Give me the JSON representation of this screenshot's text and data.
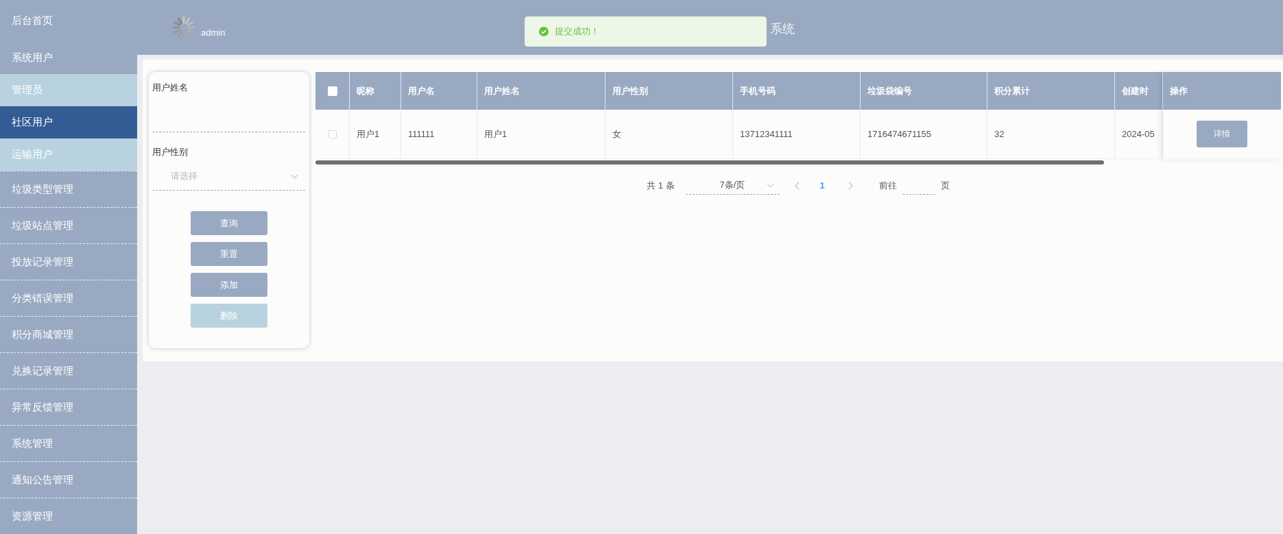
{
  "sidebar": {
    "items": [
      {
        "label": "后台首页",
        "selected": false
      },
      {
        "label": "系统用户",
        "selected": false,
        "expanded": true,
        "children": [
          {
            "label": "管理员",
            "selected": false
          },
          {
            "label": "社区用户",
            "selected": true
          },
          {
            "label": "运输用户",
            "selected": false
          }
        ]
      },
      {
        "label": "垃圾类型管理",
        "selected": false
      },
      {
        "label": "垃圾站点管理",
        "selected": false
      },
      {
        "label": "投放记录管理",
        "selected": false
      },
      {
        "label": "分类错误管理",
        "selected": false
      },
      {
        "label": "积分商城管理",
        "selected": false
      },
      {
        "label": "兑换记录管理",
        "selected": false
      },
      {
        "label": "异常反馈管理",
        "selected": false
      },
      {
        "label": "系统管理",
        "selected": false
      },
      {
        "label": "通知公告管理",
        "selected": false
      },
      {
        "label": "资源管理",
        "selected": false
      }
    ]
  },
  "header": {
    "user": "admin",
    "title": "系统"
  },
  "toast": {
    "kind": "success",
    "message": "提交成功！"
  },
  "search": {
    "fields": [
      {
        "kind": "input",
        "label": "用户姓名"
      },
      {
        "kind": "select",
        "label": "用户性别",
        "placeholder": "请选择"
      }
    ],
    "buttons": [
      {
        "label": "查询",
        "disabled": false
      },
      {
        "label": "重置",
        "disabled": false
      },
      {
        "label": "添加",
        "disabled": false
      },
      {
        "label": "删除",
        "disabled": true
      }
    ]
  },
  "table": {
    "all_checked": false,
    "columns": [
      "昵称",
      "用户名",
      "用户姓名",
      "用户性别",
      "手机号码",
      "垃圾袋编号",
      "积分累计",
      "创建时"
    ],
    "action_column": "操作",
    "rows": [
      {
        "selected": false,
        "cells": [
          "用户1",
          "111111",
          "用户1",
          "女",
          "13712341111",
          "1716474671155",
          "32",
          "2024-05"
        ],
        "action": "详情"
      }
    ]
  },
  "pagination": {
    "total": "共 1 条",
    "page_size": "7条/页",
    "pages": [
      {
        "label": "1",
        "selected": true
      }
    ],
    "goto_label": "前往",
    "goto_suffix": "页"
  }
}
